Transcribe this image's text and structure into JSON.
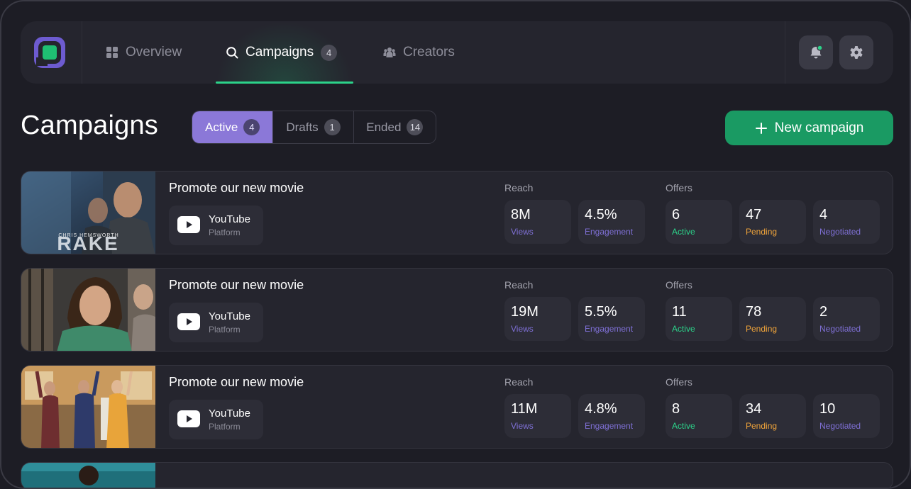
{
  "nav": {
    "items": [
      {
        "label": "Overview",
        "icon": "grid-icon"
      },
      {
        "label": "Campaigns",
        "icon": "search-icon",
        "badge": "4",
        "active": true
      },
      {
        "label": "Creators",
        "icon": "users-icon"
      }
    ],
    "actions": [
      "bell-icon",
      "gear-icon"
    ]
  },
  "page": {
    "title": "Campaigns",
    "tabs": [
      {
        "label": "Active",
        "count": "4"
      },
      {
        "label": "Drafts",
        "count": "1"
      },
      {
        "label": "Ended",
        "count": "14"
      }
    ],
    "new_button": "New campaign"
  },
  "labels": {
    "reach": "Reach",
    "offers": "Offers"
  },
  "campaigns": [
    {
      "title": "Promote our new movie",
      "platform": "YouTube",
      "platform_sub": "Platform",
      "thumb_text": "RAKE",
      "thumb_caption": "CHRIS HEMSWORTH",
      "views": "8M",
      "views_label": "Views",
      "engagement": "4.5%",
      "engagement_label": "Engagement",
      "active": "6",
      "active_label": "Active",
      "pending": "47",
      "pending_label": "Pending",
      "negotiated": "4",
      "negotiated_label": "Negotiated"
    },
    {
      "title": "Promote our new movie",
      "platform": "YouTube",
      "platform_sub": "Platform",
      "views": "19M",
      "views_label": "Views",
      "engagement": "5.5%",
      "engagement_label": "Engagement",
      "active": "11",
      "active_label": "Active",
      "pending": "78",
      "pending_label": "Pending",
      "negotiated": "2",
      "negotiated_label": "Negotiated"
    },
    {
      "title": "Promote our new movie",
      "platform": "YouTube",
      "platform_sub": "Platform",
      "views": "11M",
      "views_label": "Views",
      "engagement": "4.8%",
      "engagement_label": "Engagement",
      "active": "8",
      "active_label": "Active",
      "pending": "34",
      "pending_label": "Pending",
      "negotiated": "10",
      "negotiated_label": "Negotiated"
    }
  ],
  "colors": {
    "accent_green": "#1a9a63",
    "accent_purple": "#8b78d8",
    "active_green": "#2cd28a",
    "pending_orange": "#f0a43a"
  }
}
